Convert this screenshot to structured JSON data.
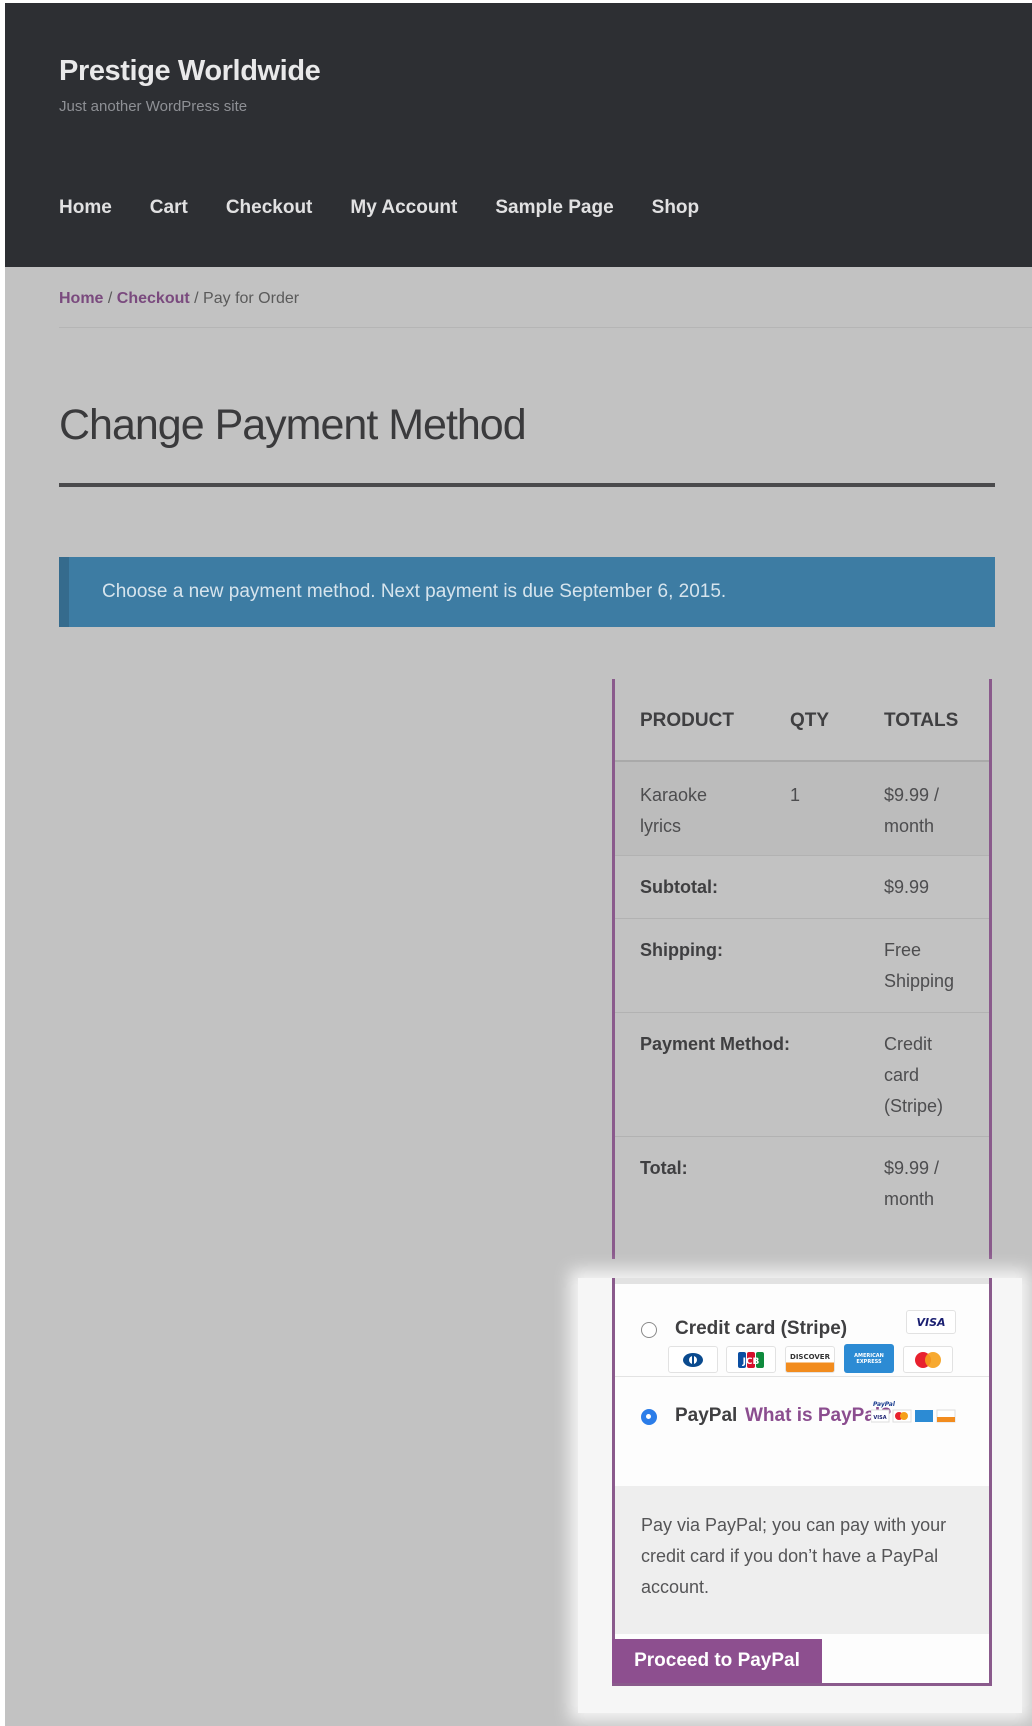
{
  "site": {
    "title": "Prestige Worldwide",
    "tagline": "Just another WordPress site"
  },
  "nav": [
    "Home",
    "Cart",
    "Checkout",
    "My Account",
    "Sample Page",
    "Shop"
  ],
  "breadcrumb": {
    "home": "Home",
    "sep1": " / ",
    "checkout": "Checkout",
    "sep2": " / ",
    "current": "Pay for Order"
  },
  "page_title": "Change Payment Method",
  "notice": "Choose a new payment method. Next payment is due September 6, 2015.",
  "order_table": {
    "headers": [
      "PRODUCT",
      "QTY",
      "TOTALS"
    ],
    "item": {
      "name": "Karaoke lyrics",
      "qty": "1",
      "total": "$9.99 / month"
    },
    "subtotal": {
      "label": "Subtotal:",
      "value": "$9.99"
    },
    "shipping": {
      "label": "Shipping:",
      "value": "Free Shipping"
    },
    "payment_method": {
      "label": "Payment Method:",
      "value": "Credit card (Stripe)"
    },
    "total": {
      "label": "Total:",
      "value": "$9.99 / month"
    }
  },
  "payment": {
    "methods": [
      {
        "label": "Credit card (Stripe)",
        "selected": false,
        "cards": [
          "VISA",
          "DINERS",
          "JCB",
          "DISCOVER",
          "AMERICAN EXPRESS",
          "MasterCard"
        ]
      },
      {
        "label": "PayPal",
        "link": "What is PayPal?",
        "selected": true,
        "logo_text": "PayPal"
      }
    ],
    "description": "Pay via PayPal; you can pay with your credit card if you don’t have a PayPal account.",
    "button": "Proceed to PayPal"
  },
  "colors": {
    "header_bg": "#2d2f33",
    "link_purple": "#7a4a7e",
    "notice_blue": "#3d7ca3",
    "button_purple": "#8d4f8f",
    "radio_blue": "#2b7de9"
  }
}
